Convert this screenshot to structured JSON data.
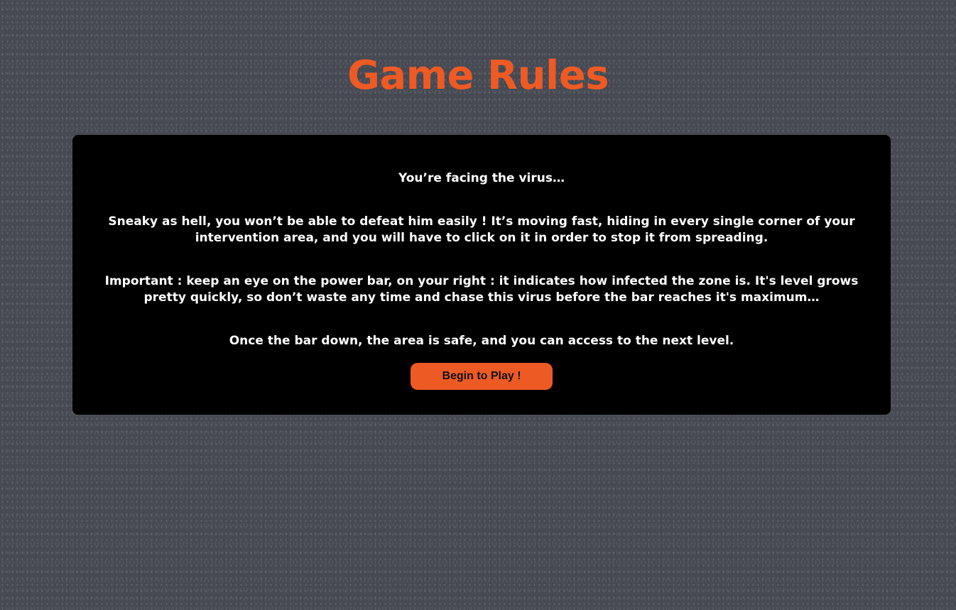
{
  "page": {
    "title": "Game Rules"
  },
  "rules": {
    "paragraphs": [
      "You’re facing the virus…",
      "Sneaky as hell, you won’t be able to defeat him easily ! It’s moving fast, hiding in every single corner of your intervention area, and you will have to click on it in order to stop it from spreading.",
      "Important : keep an eye on the power bar, on your right : it indicates how infected the zone is. It's level grows pretty quickly, so don’t waste any time and chase this virus before the bar reaches it's maximum…",
      "Once the bar down, the area is safe, and you can access to the next level."
    ],
    "play_button_label": "Begin to Play !"
  },
  "colors": {
    "accent": "#ee5a24",
    "background": "#474a53",
    "panel": "#000000",
    "text": "#ffffff"
  }
}
